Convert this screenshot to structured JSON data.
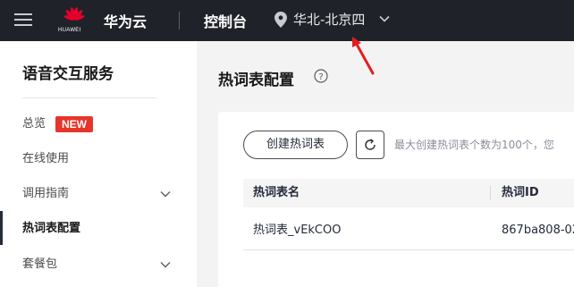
{
  "topbar": {
    "logo_text": "HUAWEI",
    "brand": "华为云",
    "console": "控制台",
    "region": "华北-北京四"
  },
  "sidebar": {
    "title": "语音交互服务",
    "new_badge": "NEW",
    "items": [
      {
        "label": "总览"
      },
      {
        "label": "在线使用"
      },
      {
        "label": "调用指南"
      },
      {
        "label": "热词表配置"
      },
      {
        "label": "套餐包"
      }
    ]
  },
  "main": {
    "title": "热词表配置",
    "create_button": "创建热词表",
    "hint": "最大创建热词表个数为100个，您",
    "table": {
      "columns": [
        "热词表名",
        "热词ID"
      ],
      "rows": [
        {
          "name": "热词表_vEkCOO",
          "id": "867ba808-02"
        }
      ]
    }
  },
  "colors": {
    "topbar_bg": "#1f2329",
    "badge_red": "#e6352b",
    "arrow_red": "#e02020",
    "logo_red": "#e4002b"
  }
}
